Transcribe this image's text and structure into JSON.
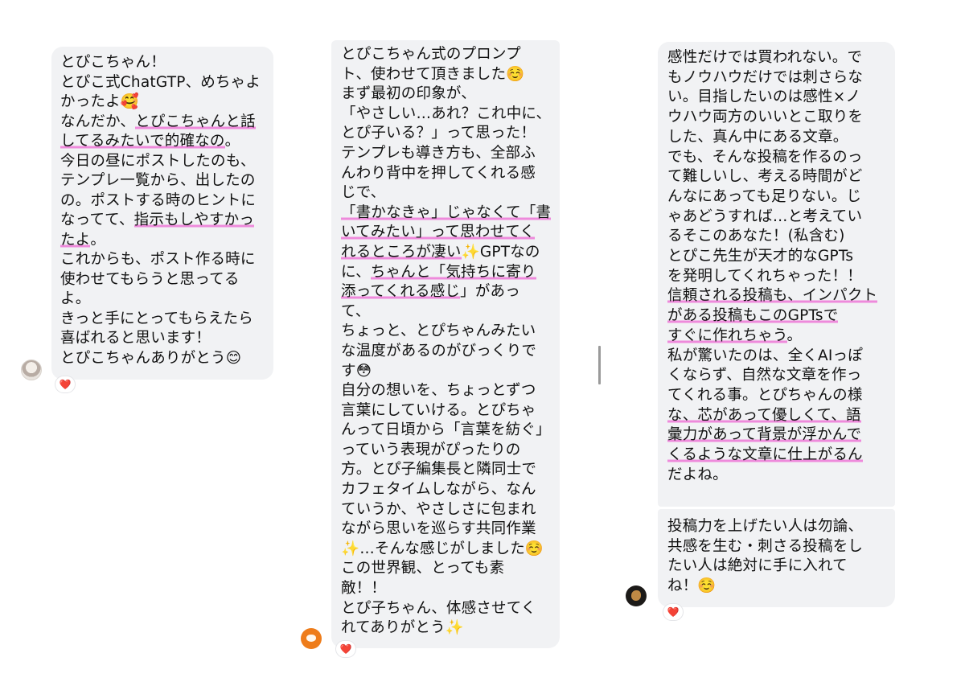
{
  "message1": {
    "lines": [
      {
        "before": "とぴこちゃん！",
        "hl": "",
        "after": ""
      },
      {
        "before": "とぴこ式ChatGTP、めちゃよ",
        "hl": "",
        "after": ""
      },
      {
        "before": "かったよ🥰",
        "hl": "",
        "after": ""
      },
      {
        "before": "なんだか、",
        "hl": "とぴこちゃんと話",
        "after": ""
      },
      {
        "before": "",
        "hl": "してるみたいで的確なの",
        "after": "。"
      },
      {
        "before": "今日の昼にポストしたのも、",
        "hl": "",
        "after": ""
      },
      {
        "before": "テンプレ一覧から、出したの",
        "hl": "",
        "after": ""
      },
      {
        "before": "の。ポストする時のヒントに",
        "hl": "",
        "after": ""
      },
      {
        "before": "なってて、",
        "hl": "指示もしやすかっ",
        "after": ""
      },
      {
        "before": "",
        "hl": "たよ",
        "after": "。"
      },
      {
        "before": "これからも、ポスト作る時に",
        "hl": "",
        "after": ""
      },
      {
        "before": "使わせてもらうと思ってる",
        "hl": "",
        "after": ""
      },
      {
        "before": "よ。",
        "hl": "",
        "after": ""
      },
      {
        "before": "きっと手にとってもらえたら",
        "hl": "",
        "after": ""
      },
      {
        "before": "喜ばれると思います！",
        "hl": "",
        "after": ""
      },
      {
        "before": "とぴこちゃんありがとう😊",
        "hl": "",
        "after": ""
      }
    ],
    "reaction": "❤️"
  },
  "message2": {
    "lines": [
      {
        "before": "とぴこちゃん式のプロンプ",
        "hl": "",
        "after": ""
      },
      {
        "before": "ト、使わせて頂きました☺️",
        "hl": "",
        "after": ""
      },
      {
        "before": "まず最初の印象が、",
        "hl": "",
        "after": ""
      },
      {
        "before": "「やさしい…あれ？これ中に、",
        "hl": "",
        "after": ""
      },
      {
        "before": "とぴ子いる？」って思った！",
        "hl": "",
        "after": ""
      },
      {
        "before": "テンプレも導き方も、全部ふ",
        "hl": "",
        "after": ""
      },
      {
        "before": "んわり背中を押してくれる感",
        "hl": "",
        "after": ""
      },
      {
        "before": "じで、",
        "hl": "",
        "after": ""
      },
      {
        "before": "",
        "hl": "「書かなきゃ」じゃなくて「書",
        "after": ""
      },
      {
        "before": "",
        "hl": "いてみたい」って思わせてく",
        "after": ""
      },
      {
        "before": "",
        "hl": "れるところが凄い",
        "after": "✨GPTなの"
      },
      {
        "before": "に、",
        "hl": "ちゃんと「気持ちに寄り",
        "after": ""
      },
      {
        "before": "",
        "hl": "添ってくれる感じ",
        "after": "」があっ"
      },
      {
        "before": "て、",
        "hl": "",
        "after": ""
      },
      {
        "before": "ちょっと、とぴちゃんみたい",
        "hl": "",
        "after": ""
      },
      {
        "before": "な温度があるのがびっくりで",
        "hl": "",
        "after": ""
      },
      {
        "before": "す😳",
        "hl": "",
        "after": ""
      },
      {
        "before": "自分の想いを、ちょっとずつ",
        "hl": "",
        "after": ""
      },
      {
        "before": "言葉にしていける。とぴちゃ",
        "hl": "",
        "after": ""
      },
      {
        "before": "んって日頃から「言葉を紡ぐ」",
        "hl": "",
        "after": ""
      },
      {
        "before": "っていう表現がぴったりの",
        "hl": "",
        "after": ""
      },
      {
        "before": "方。とぴ子編集長と隣同士で",
        "hl": "",
        "after": ""
      },
      {
        "before": "カフェタイムしながら、なん",
        "hl": "",
        "after": ""
      },
      {
        "before": "ていうか、やさしさに包まれ",
        "hl": "",
        "after": ""
      },
      {
        "before": "ながら思いを巡らす共同作業",
        "hl": "",
        "after": ""
      },
      {
        "before": "✨…そんな感じがしました☺️",
        "hl": "",
        "after": ""
      },
      {
        "before": "この世界観、とっても素",
        "hl": "",
        "after": ""
      },
      {
        "before": "敵！！",
        "hl": "",
        "after": ""
      },
      {
        "before": "とぴ子ちゃん、体感させてく",
        "hl": "",
        "after": ""
      },
      {
        "before": "れてありがとう✨",
        "hl": "",
        "after": ""
      }
    ],
    "reaction": "❤️"
  },
  "message3a": {
    "lines": [
      {
        "before": "感性だけでは買われない。で",
        "hl": "",
        "after": ""
      },
      {
        "before": "もノウハウだけでは刺さらな",
        "hl": "",
        "after": ""
      },
      {
        "before": "い。目指したいのは感性×ノ",
        "hl": "",
        "after": ""
      },
      {
        "before": "ウハウ両方のいいとこ取りを",
        "hl": "",
        "after": ""
      },
      {
        "before": "した、真ん中にある文章。",
        "hl": "",
        "after": ""
      },
      {
        "before": "でも、そんな投稿を作るのっ",
        "hl": "",
        "after": ""
      },
      {
        "before": "て難しいし、考える時間がど",
        "hl": "",
        "after": ""
      },
      {
        "before": "んなにあっても足りない。じ",
        "hl": "",
        "after": ""
      },
      {
        "before": "ゃあどうすれば…と考えてい",
        "hl": "",
        "after": ""
      },
      {
        "before": "るそこのあなた！(私含む)",
        "hl": "",
        "after": ""
      },
      {
        "before": "とぴこ先生が天才的なGPTs",
        "hl": "",
        "after": ""
      },
      {
        "before": "を発明してくれちゃった！！",
        "hl": "",
        "after": ""
      },
      {
        "before": "",
        "hl": "信頼される投稿も、インパクト",
        "after": ""
      },
      {
        "before": "",
        "hl": "がある投稿もこのGPTsで",
        "after": ""
      },
      {
        "before": "",
        "hl": "すぐに作れちゃう",
        "after": "。"
      },
      {
        "before": "私が驚いたのは、全くAIっぽ",
        "hl": "",
        "after": ""
      },
      {
        "before": "くならず、自然な文章を作っ",
        "hl": "",
        "after": ""
      },
      {
        "before": "てくれる事。とぴちゃんの様",
        "hl": "",
        "after": ""
      },
      {
        "before": "",
        "hl": "な、芯があって優しくて、語",
        "after": ""
      },
      {
        "before": "",
        "hl": "彙力があって背景が浮かんで",
        "after": ""
      },
      {
        "before": "",
        "hl": "くるような文章に仕上がるん",
        "after": ""
      },
      {
        "before": "だよね。",
        "hl": "",
        "after": ""
      }
    ]
  },
  "message3b": {
    "lines": [
      {
        "before": "投稿力を上げたい人は勿論、",
        "hl": "",
        "after": ""
      },
      {
        "before": "共感を生む・刺さる投稿をし",
        "hl": "",
        "after": ""
      },
      {
        "before": "たい人は絶対に手に入れて",
        "hl": "",
        "after": ""
      },
      {
        "before": "ね！☺️",
        "hl": "",
        "after": ""
      }
    ],
    "reaction": "❤️"
  }
}
